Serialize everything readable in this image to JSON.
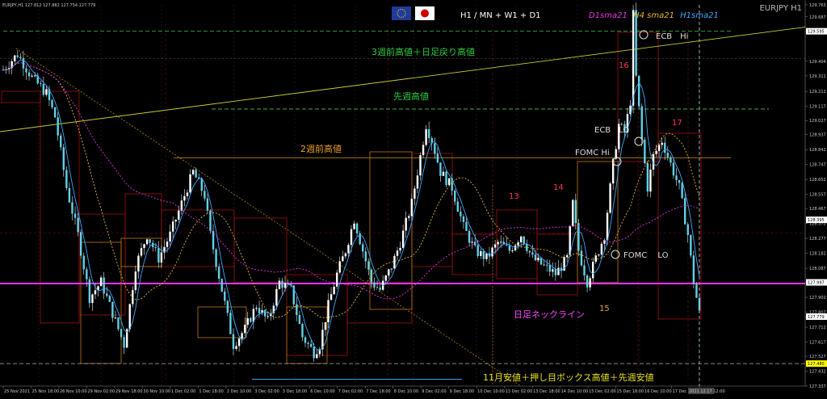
{
  "chart_data": {
    "type": "candlestick",
    "symbol_info": "EURJPY,H1  127.812 127.882 127.754 127.779",
    "header": {
      "timeframes": "H1 / MN + W1 + D1",
      "ma_legend": [
        {
          "text": "D1sma21",
          "color": "#e830e8"
        },
        {
          "text": "H4 sma21",
          "color": "#e8b830"
        },
        {
          "text": "H1sma21",
          "color": "#3aa8ff"
        }
      ],
      "pair": "EURJPY H1",
      "flags": [
        "eu-flag-icon",
        "japan-flag-icon"
      ]
    },
    "ylim": [
      127.337,
      129.763
    ],
    "y_ticks": [
      "129.763",
      "129.687",
      "129.598",
      "129.404",
      "129.311",
      "129.212",
      "129.117",
      "129.027",
      "128.937",
      "128.842",
      "128.747",
      "128.652",
      "128.557",
      "128.467",
      "128.372",
      "128.277",
      "128.182",
      "128.087",
      "127.997",
      "127.902",
      "127.807",
      "127.779",
      "127.712",
      "127.617",
      "127.527",
      "127.432",
      "127.337"
    ],
    "price_markers": [
      {
        "text": "129.595",
        "value": 129.595,
        "color": "#ffffff"
      },
      {
        "text": "128.395",
        "value": 128.395,
        "color": "#ffffff"
      },
      {
        "text": "127.997",
        "value": 127.997,
        "color": "#ffffff"
      },
      {
        "text": "127.779",
        "value": 127.779,
        "color": "#ffffff"
      },
      {
        "text": "127.480",
        "value": 127.48,
        "color": "#ffff00"
      }
    ],
    "x_ticks": [
      "25 Nov 2021",
      "25 Nov 18:00",
      "26 Nov 10:00",
      "29 Nov 02:00",
      "29 Nov 18:00",
      "30 Nov 10:00",
      "1 Dec 02:00",
      "1 Dec 18:00",
      "2 Dec 10:00",
      "3 Dec 02:00",
      "3 Dec 18:00",
      "6 Dec 10:00",
      "7 Dec 02:00",
      "7 Dec 18:00",
      "8 Dec 10:00",
      "9 Dec 02:00",
      "9 Dec 18:00",
      "10 Dec 10:00",
      "13 Dec 02:00",
      "13 Dec 18:00",
      "14 Dec 10:00",
      "15 Dec 02:00",
      "15 Dec 18:00",
      "16 Dec 10:00",
      "17 Dec 02:00",
      "2021.12.17 12:00"
    ],
    "horizontal_levels": [
      {
        "value": 129.595,
        "color": "#3cb043",
        "style": "dashed"
      },
      {
        "value": 129.1,
        "color": "#3cb043",
        "style": "dashed"
      },
      {
        "value": 128.79,
        "color": "#b8860b",
        "style": "solid"
      },
      {
        "value": 127.99,
        "color": "#ff33ff",
        "style": "solid"
      },
      {
        "value": 127.48,
        "color": "#999999",
        "style": "dashed"
      },
      {
        "value": 127.38,
        "color": "#4aa8ff",
        "style": "solid"
      }
    ],
    "annotations": [
      {
        "text": "3週前高値＋日足戻り高値",
        "color": "#2ecc40"
      },
      {
        "text": "先週高値",
        "color": "#2ecc40"
      },
      {
        "text": "2週前高値",
        "color": "#e8a020"
      },
      {
        "text": "日足ネックライン",
        "color": "#ff44ff"
      },
      {
        "text": "11月安値＋押し目ボックス高値＋先週安値",
        "color": "#e8e020"
      },
      {
        "text": "ECB　Hi",
        "color": "#dddddd"
      },
      {
        "text": "ECB　LO",
        "color": "#dddddd"
      },
      {
        "text": "FOMC Hi",
        "color": "#dddddd"
      },
      {
        "text": "FOMC　 LO",
        "color": "#dddddd"
      },
      {
        "text": "13",
        "color": "#ff3355"
      },
      {
        "text": "14",
        "color": "#ff3355"
      },
      {
        "text": "15",
        "color": "#e8a020"
      },
      {
        "text": "16",
        "color": "#ff3355"
      },
      {
        "text": "17",
        "color": "#ff3355"
      }
    ],
    "close_path": [
      [
        0,
        129.35
      ],
      [
        5,
        129.45
      ],
      [
        10,
        129.3
      ],
      [
        15,
        129.2
      ],
      [
        18,
        129.05
      ],
      [
        22,
        128.6
      ],
      [
        26,
        128.3
      ],
      [
        30,
        127.9
      ],
      [
        34,
        128.0
      ],
      [
        38,
        127.8
      ],
      [
        42,
        127.6
      ],
      [
        46,
        128.1
      ],
      [
        50,
        128.3
      ],
      [
        54,
        128.15
      ],
      [
        58,
        128.3
      ],
      [
        62,
        128.5
      ],
      [
        66,
        128.7
      ],
      [
        70,
        128.55
      ],
      [
        72,
        128.3
      ],
      [
        76,
        127.95
      ],
      [
        80,
        127.6
      ],
      [
        84,
        127.7
      ],
      [
        88,
        127.85
      ],
      [
        92,
        127.75
      ],
      [
        96,
        128.0
      ],
      [
        100,
        127.95
      ],
      [
        104,
        127.65
      ],
      [
        108,
        127.55
      ],
      [
        110,
        127.6
      ],
      [
        113,
        127.85
      ],
      [
        116,
        128.05
      ],
      [
        119,
        128.2
      ],
      [
        122,
        128.4
      ],
      [
        125,
        128.2
      ],
      [
        128,
        128.0
      ],
      [
        131,
        127.95
      ],
      [
        135,
        128.1
      ],
      [
        138,
        128.25
      ],
      [
        142,
        128.5
      ],
      [
        145,
        128.8
      ],
      [
        147,
        129.0
      ],
      [
        149,
        128.9
      ],
      [
        152,
        128.7
      ],
      [
        156,
        128.6
      ],
      [
        160,
        128.35
      ],
      [
        164,
        128.2
      ],
      [
        168,
        128.15
      ],
      [
        172,
        128.25
      ],
      [
        176,
        128.2
      ],
      [
        180,
        128.3
      ],
      [
        184,
        128.15
      ],
      [
        188,
        128.1
      ],
      [
        192,
        128.05
      ],
      [
        196,
        128.15
      ],
      [
        198,
        128.5
      ],
      [
        200,
        128.2
      ],
      [
        203,
        128.0
      ],
      [
        206,
        128.15
      ],
      [
        209,
        128.3
      ],
      [
        212,
        128.75
      ],
      [
        214,
        129.0
      ],
      [
        216,
        128.95
      ],
      [
        218,
        129.15
      ],
      [
        219,
        129.7
      ],
      [
        220,
        129.3
      ],
      [
        222,
        128.9
      ],
      [
        224,
        128.6
      ],
      [
        226,
        128.8
      ],
      [
        229,
        128.9
      ],
      [
        232,
        128.75
      ],
      [
        235,
        128.6
      ],
      [
        238,
        128.3
      ],
      [
        240,
        128.0
      ],
      [
        242,
        127.8
      ]
    ]
  }
}
